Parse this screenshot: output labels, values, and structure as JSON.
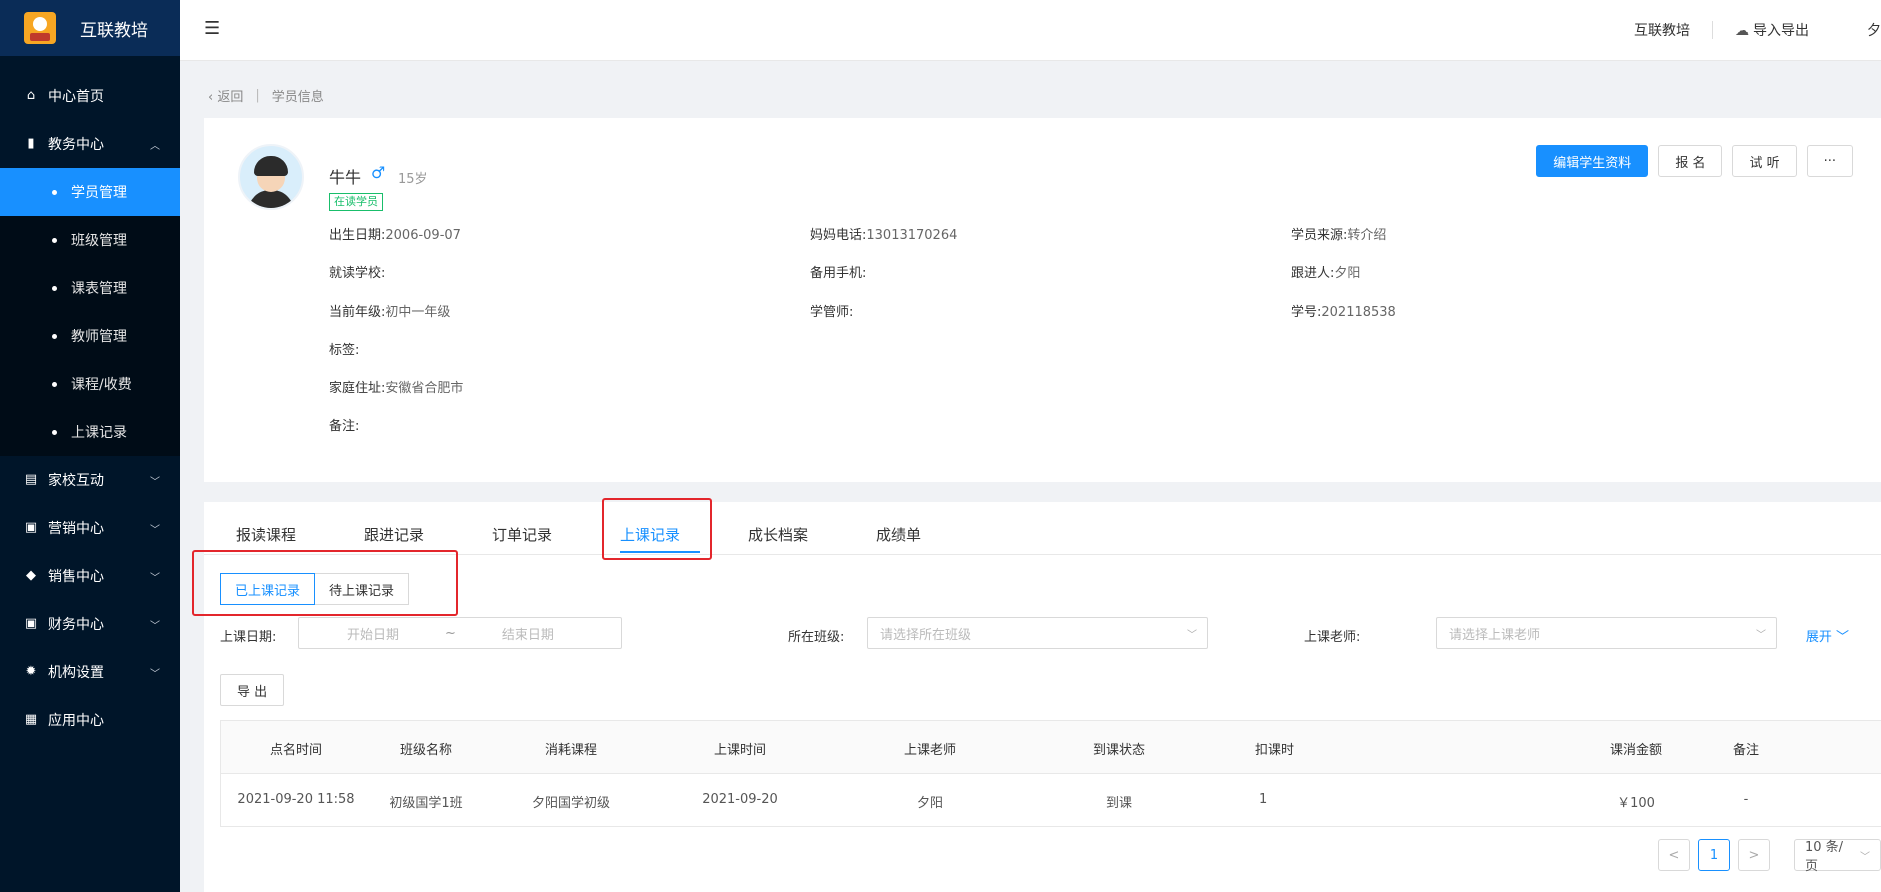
{
  "app": {
    "brand": "互联教培"
  },
  "sidebar": {
    "items": [
      {
        "label": "中心首页",
        "icon": "home-icon"
      },
      {
        "label": "教务中心",
        "icon": "book-icon",
        "expanded": true,
        "children": [
          "学员管理",
          "班级管理",
          "课表管理",
          "教师管理",
          "课程/收费",
          "上课记录"
        ]
      },
      {
        "label": "家校互动",
        "icon": "chat-icon"
      },
      {
        "label": "营销中心",
        "icon": "bag-icon"
      },
      {
        "label": "销售中心",
        "icon": "user-icon"
      },
      {
        "label": "财务中心",
        "icon": "wallet-icon"
      },
      {
        "label": "机构设置",
        "icon": "gear-icon"
      },
      {
        "label": "应用中心",
        "icon": "grid-icon"
      }
    ],
    "active_child": "学员管理"
  },
  "topbar": {
    "org": "互联教培",
    "import_export": "导入导出",
    "user": "夕"
  },
  "breadcrumb": {
    "back": "返回",
    "current": "学员信息"
  },
  "student": {
    "name": "牛牛",
    "gender_symbol": "♂",
    "age": "15岁",
    "status_tag": "在读学员",
    "fields": {
      "birth_label": "出生日期:",
      "birth": "2006-09-07",
      "mom_phone_label": "妈妈电话:",
      "mom_phone": "13013170264",
      "source_label": "学员来源:",
      "source": "转介绍",
      "school_label": "就读学校:",
      "school": "",
      "backup_phone_label": "备用手机:",
      "backup_phone": "",
      "follower_label": "跟进人:",
      "follower": "夕阳",
      "grade_label": "当前年级:",
      "grade": "初中一年级",
      "manager_label": "学管师:",
      "manager": "",
      "student_no_label": "学号:",
      "student_no": "202118538",
      "tags_label": "标签:",
      "tags": "",
      "address_label": "家庭住址:",
      "address": "安徽省合肥市",
      "remark_label": "备注:",
      "remark": ""
    }
  },
  "actions": {
    "edit": "编辑学生资料",
    "enroll": "报 名",
    "trial": "试 听",
    "more": "···"
  },
  "tabs": [
    "报读课程",
    "跟进记录",
    "订单记录",
    "上课记录",
    "成长档案",
    "成绩单"
  ],
  "active_tab": "上课记录",
  "segments": {
    "done": "已上课记录",
    "pending": "待上课记录",
    "active": "done"
  },
  "filters": {
    "date_label": "上课日期:",
    "start_placeholder": "开始日期",
    "range_sep": "~",
    "end_placeholder": "结束日期",
    "class_label": "所在班级:",
    "class_placeholder": "请选择所在班级",
    "teacher_label": "上课老师:",
    "teacher_placeholder": "请选择上课老师",
    "expand": "展开"
  },
  "export_button": "导 出",
  "table": {
    "columns": [
      "点名时间",
      "班级名称",
      "消耗课程",
      "上课时间",
      "上课老师",
      "到课状态",
      "扣课时",
      "课消金额",
      "备注"
    ],
    "rows": [
      [
        "2021-09-20 11:58",
        "初级国学1班",
        "夕阳国学初级",
        "2021-09-20",
        "夕阳",
        "到课",
        "1",
        "￥100",
        "-"
      ]
    ]
  },
  "pagination": {
    "prev": "<",
    "page": "1",
    "next": ">",
    "page_size": "10 条/页"
  },
  "colors": {
    "sidebar_bg": "#001529",
    "accent": "#1890ff",
    "highlight_box": "#e3262c",
    "status_tag": "#19be6b"
  }
}
